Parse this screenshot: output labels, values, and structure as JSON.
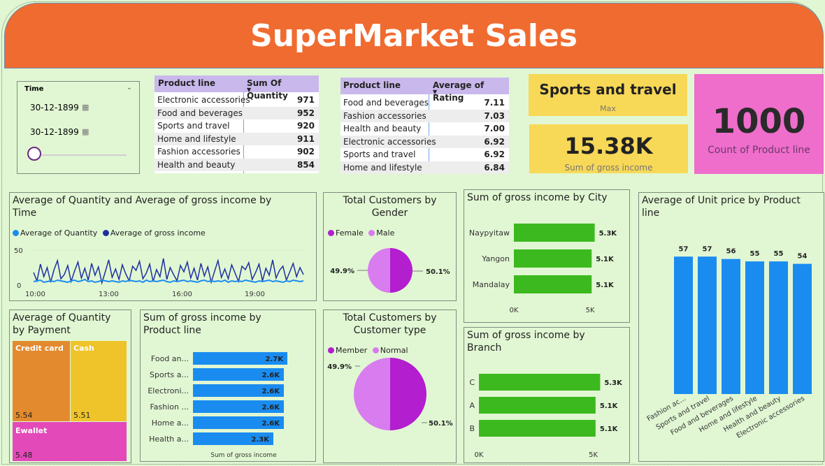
{
  "title": "SuperMarket Sales",
  "slicer": {
    "label": "Time",
    "start_date": "30-12-1899",
    "end_date": "30-12-1899"
  },
  "quantity_table": {
    "headers": [
      "Product line",
      "Sum Of Quantity"
    ],
    "rows": [
      [
        "Electronic accessories",
        "971"
      ],
      [
        "Food and beverages",
        "952"
      ],
      [
        "Sports and travel",
        "920"
      ],
      [
        "Home and lifestyle",
        "911"
      ],
      [
        "Fashion accessories",
        "902"
      ],
      [
        "Health and beauty",
        "854"
      ]
    ]
  },
  "rating_table": {
    "headers": [
      "Product line",
      "Average of Rating"
    ],
    "rows": [
      [
        "Food and beverages",
        "7.11"
      ],
      [
        "Fashion accessories",
        "7.03"
      ],
      [
        "Health and beauty",
        "7.00"
      ],
      [
        "Electronic accessories",
        "6.92"
      ],
      [
        "Sports and travel",
        "6.92"
      ],
      [
        "Home and lifestyle",
        "6.84"
      ]
    ]
  },
  "kpis": {
    "max_product": {
      "value": "Sports and travel",
      "label": "Max"
    },
    "gross_income": {
      "value": "15.38K",
      "label": "Sum of gross income"
    },
    "count_product": {
      "value": "1000",
      "label": "Count of Product line"
    }
  },
  "colors": {
    "banner": "#f06b30",
    "bar_blue": "#1a8cf0",
    "bar_green": "#3cb91e",
    "kpi_yellow": "#f7d857",
    "kpi_pink": "#ef6dcb",
    "female": "#b31ecf",
    "male": "#d87cef",
    "quantity_line": "#1a8cf0",
    "income_line": "#1d2fa0",
    "credit_card": "#e38a2f",
    "cash": "#efc42a",
    "ewallet": "#e349b9"
  },
  "chart_data": [
    {
      "id": "time_series",
      "type": "line",
      "title": "Average of Quantity and Average of gross income by\nTime",
      "x_ticks": [
        "10:00",
        "13:00",
        "16:00",
        "19:00"
      ],
      "y_ticks": [
        "0",
        "50"
      ],
      "ylim": [
        0,
        50
      ],
      "series": [
        {
          "name": "Average of Quantity",
          "color": "#1a8cf0",
          "values": [
            5,
            6,
            7,
            4,
            5,
            6,
            5,
            7,
            6,
            5,
            4,
            6,
            7,
            5,
            6,
            8,
            5,
            6,
            4,
            5,
            7,
            6,
            5,
            6,
            5,
            4,
            6,
            5,
            7,
            6,
            5,
            6,
            4,
            7,
            5,
            6,
            5,
            6,
            7,
            5,
            4,
            6,
            5,
            6,
            7,
            5,
            6,
            5,
            4,
            6,
            7,
            5,
            6,
            5,
            6,
            5,
            7,
            4,
            6,
            5,
            6,
            5,
            7,
            6,
            5,
            4,
            6,
            5,
            6,
            7,
            5,
            6,
            5,
            4,
            6,
            5,
            7,
            6,
            5,
            6
          ]
        },
        {
          "name": "Average of gross income",
          "color": "#1d2fa0",
          "values": [
            18,
            6,
            30,
            12,
            25,
            4,
            22,
            35,
            9,
            15,
            28,
            5,
            20,
            33,
            10,
            24,
            7,
            31,
            14,
            26,
            3,
            19,
            36,
            11,
            23,
            8,
            29,
            16,
            6,
            27,
            21,
            34,
            9,
            17,
            30,
            5,
            22,
            12,
            38,
            8,
            25,
            15,
            6,
            28,
            19,
            33,
            10,
            24,
            7,
            31,
            13,
            26,
            4,
            20,
            35,
            11,
            23,
            9,
            29,
            17,
            5,
            27,
            22,
            32,
            8,
            18,
            30,
            6,
            24,
            14,
            36,
            10,
            21,
            27,
            7,
            19,
            31,
            12,
            25,
            15
          ]
        }
      ]
    },
    {
      "id": "gender",
      "type": "pie",
      "title": "Total Customers by\nGender",
      "categories": [
        "Female",
        "Male"
      ],
      "values": [
        50.1,
        49.9
      ],
      "labels": [
        "50.1%",
        "49.9%"
      ]
    },
    {
      "id": "city",
      "type": "bar",
      "orientation": "horizontal",
      "title": "Sum of gross income by City",
      "categories": [
        "Naypyitaw",
        "Yangon",
        "Mandalay"
      ],
      "values": [
        5.3,
        5.1,
        5.1
      ],
      "labels": [
        "5.3K",
        "5.1K",
        "5.1K"
      ],
      "x_ticks": [
        "0K",
        "5K"
      ],
      "xlim": [
        0,
        5.96
      ]
    },
    {
      "id": "unit_price",
      "type": "bar",
      "title": "Average of Unit price by Product\nline",
      "categories": [
        "Fashion ac...",
        "Sports and travel",
        "Food and beverages",
        "Home and lifestyle",
        "Health and beauty",
        "Electronic accessories"
      ],
      "values": [
        57,
        57,
        56,
        55,
        55,
        54
      ],
      "labels": [
        "57",
        "57",
        "56",
        "55",
        "55",
        "54"
      ],
      "ylim": [
        0,
        62
      ]
    },
    {
      "id": "payment",
      "type": "treemap",
      "title": "Average of Quantity\nby Payment",
      "categories": [
        "Credit card",
        "Cash",
        "Ewallet"
      ],
      "values": [
        5.54,
        5.51,
        5.48
      ],
      "labels": [
        "5.54",
        "5.51",
        "5.48"
      ]
    },
    {
      "id": "product_income",
      "type": "bar",
      "orientation": "horizontal",
      "title": "Sum of gross income by\nProduct line",
      "categories": [
        "Food an...",
        "Sports a...",
        "Electroni...",
        "Fashion ...",
        "Home a...",
        "Health a..."
      ],
      "values": [
        2.7,
        2.6,
        2.6,
        2.6,
        2.6,
        2.3
      ],
      "labels": [
        "2.7K",
        "2.6K",
        "2.6K",
        "2.6K",
        "2.6K",
        "2.3K"
      ],
      "xlabel": "Sum of gross income",
      "xlim": [
        0,
        2.9
      ]
    },
    {
      "id": "customer_type",
      "type": "pie",
      "title": "Total Customers by\nCustomer type",
      "categories": [
        "Member",
        "Normal"
      ],
      "values": [
        50.1,
        49.9
      ],
      "labels": [
        "50.1%",
        "49.9%"
      ]
    },
    {
      "id": "branch",
      "type": "bar",
      "orientation": "horizontal",
      "title": "Sum of gross income by\nBranch",
      "categories": [
        "C",
        "A",
        "B"
      ],
      "values": [
        5.3,
        5.1,
        5.1
      ],
      "labels": [
        "5.3K",
        "5.1K",
        "5.1K"
      ],
      "x_ticks": [
        "0K",
        "5K"
      ],
      "xlim": [
        0,
        5.96
      ]
    }
  ]
}
